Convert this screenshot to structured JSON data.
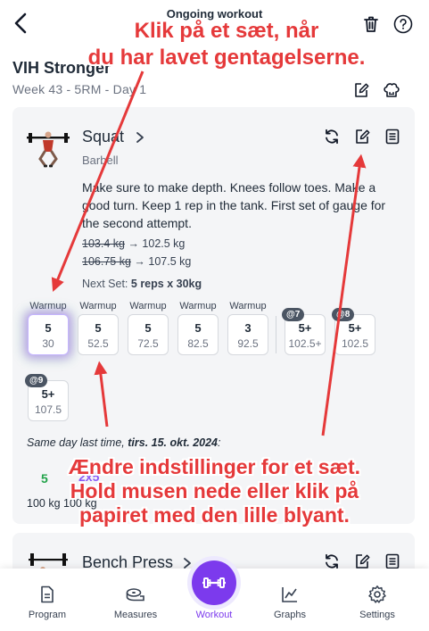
{
  "header": {
    "title": "Ongoing workout",
    "program": "VIH Stronger",
    "week_day": "Week 43 - 5RM - Day 1"
  },
  "exercise": {
    "name": "Squat",
    "equipment": "Barbell",
    "description": "Make sure to make depth. Knees follow toes. Make a good turn. Keep 1 rep in the tank. First set of gauge for the second attempt.",
    "history": [
      {
        "old": "103.4 kg",
        "arrow": " → ",
        "new": "102.5 kg"
      },
      {
        "old": "106.75 kg",
        "arrow": " → ",
        "new": "107.5 kg"
      }
    ],
    "next_set_label": "Next Set: ",
    "next_set_value": "5 reps x 30kg",
    "sets": [
      {
        "label": "Warmup",
        "reps": "5",
        "weight": "30",
        "rpe": ""
      },
      {
        "label": "Warmup",
        "reps": "5",
        "weight": "52.5",
        "rpe": ""
      },
      {
        "label": "Warmup",
        "reps": "5",
        "weight": "72.5",
        "rpe": ""
      },
      {
        "label": "Warmup",
        "reps": "5",
        "weight": "82.5",
        "rpe": ""
      },
      {
        "label": "Warmup",
        "reps": "3",
        "weight": "92.5",
        "rpe": ""
      },
      {
        "label": "",
        "reps": "5+",
        "weight": "102.5+",
        "rpe": "@7"
      },
      {
        "label": "",
        "reps": "5+",
        "weight": "102.5",
        "rpe": "@8"
      },
      {
        "label": "",
        "reps": "5+",
        "weight": "107.5",
        "rpe": "@9"
      }
    ],
    "last_time_prefix": "Same day last time, ",
    "last_time_date": "tirs. 15. okt. 2024",
    "last_time_suffix": ":",
    "last_time_green": "5",
    "last_time_purple": "2x5",
    "last_time_bottom": "100 kg   100 kg"
  },
  "next_exercise": {
    "name": "Bench Press"
  },
  "nav": {
    "program": "Program",
    "measures": "Measures",
    "workout": "Workout",
    "graphs": "Graphs",
    "settings": "Settings"
  },
  "annotations": {
    "top_line1": "Klik på et sæt, når",
    "top_line2": "du har lavet gentagelserne.",
    "bottom_line1": "Ændre indstillinger for et sæt.",
    "bottom_line2": "Hold musen nede eller klik på",
    "bottom_line3": "papiret med den lille blyant."
  },
  "colors": {
    "accent": "#7c3aed",
    "annotation": "#e5393a",
    "card_bg": "#f4f5f7"
  }
}
